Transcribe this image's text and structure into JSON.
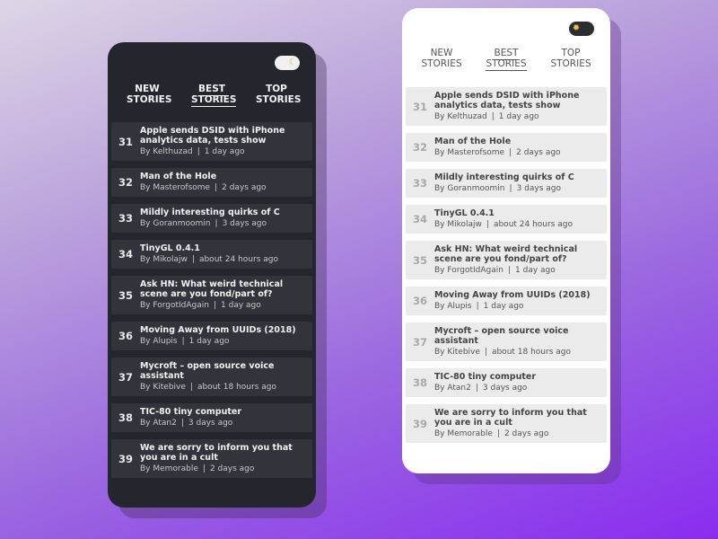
{
  "dark_phone": {
    "toggle_icon": "moon-icon",
    "tabs": [
      {
        "line1": "NEW",
        "line2": "STORIES",
        "active": false
      },
      {
        "line1": "BEST",
        "line2": "STORIES",
        "active": true
      },
      {
        "line1": "TOP",
        "line2": "STORIES",
        "active": false
      }
    ],
    "stories": [
      {
        "rank": "31",
        "title": "Apple sends DSID with iPhone analytics data, tests show",
        "author": "By Kelthuzad",
        "time": "1 day ago"
      },
      {
        "rank": "32",
        "title": "Man of the Hole",
        "author": "By Masterofsome",
        "time": "2 days ago"
      },
      {
        "rank": "33",
        "title": "Mildly interesting quirks of C",
        "author": "By Goranmoomin",
        "time": "3 days ago"
      },
      {
        "rank": "34",
        "title": "TinyGL 0.4.1",
        "author": "By Mikolajw",
        "time": "about 24 hours ago"
      },
      {
        "rank": "35",
        "title": "Ask HN: What weird technical scene are you fond/part of?",
        "author": "By ForgotIdAgain",
        "time": "1 day ago"
      },
      {
        "rank": "36",
        "title": "Moving Away from UUIDs (2018)",
        "author": "By Alupis",
        "time": "1 day ago"
      },
      {
        "rank": "37",
        "title": "Mycroft – open source voice assistant",
        "author": "By Kitebive",
        "time": "about 18 hours ago"
      },
      {
        "rank": "38",
        "title": "TIC-80 tiny computer",
        "author": "By Atan2",
        "time": "3 days ago"
      },
      {
        "rank": "39",
        "title": "We are sorry to inform you that you are in a cult",
        "author": "By Memorable",
        "time": "2 days ago"
      }
    ]
  },
  "light_phone": {
    "toggle_icon": "sun-icon",
    "tabs": [
      {
        "line1": "NEW",
        "line2": "STORIES",
        "active": false
      },
      {
        "line1": "BEST",
        "line2": "STORIES",
        "active": true
      },
      {
        "line1": "TOP",
        "line2": "STORIES",
        "active": false
      }
    ],
    "stories": [
      {
        "rank": "31",
        "title": "Apple sends DSID with iPhone analytics data, tests show",
        "author": "By Kelthuzad",
        "time": "1 day ago"
      },
      {
        "rank": "32",
        "title": "Man of the Hole",
        "author": "By Masterofsome",
        "time": "2 days ago"
      },
      {
        "rank": "33",
        "title": "Mildly interesting quirks of C",
        "author": "By Goranmoomin",
        "time": "3 days ago"
      },
      {
        "rank": "34",
        "title": "TinyGL 0.4.1",
        "author": "By Mikolajw",
        "time": "about 24 hours ago"
      },
      {
        "rank": "35",
        "title": "Ask HN: What weird technical scene are you fond/part of?",
        "author": "By ForgotIdAgain",
        "time": "1 day ago"
      },
      {
        "rank": "36",
        "title": "Moving Away from UUIDs (2018)",
        "author": "By Alupis",
        "time": "1 day ago"
      },
      {
        "rank": "37",
        "title": "Mycroft – open source voice assistant",
        "author": "By Kitebive",
        "time": "about 18 hours ago"
      },
      {
        "rank": "38",
        "title": "TIC-80 tiny computer",
        "author": "By Atan2",
        "time": "3 days ago"
      },
      {
        "rank": "39",
        "title": "We are sorry to inform you that you are in a cult",
        "author": "By Memorable",
        "time": "2 days ago"
      }
    ]
  },
  "colors": {
    "dark_bg": "#24262d",
    "dark_card": "#31343b",
    "light_bg": "#ffffff",
    "light_card": "#ebebeb",
    "page_gradient_start": "#ddd6e6",
    "page_gradient_end": "#8a2cf0"
  }
}
